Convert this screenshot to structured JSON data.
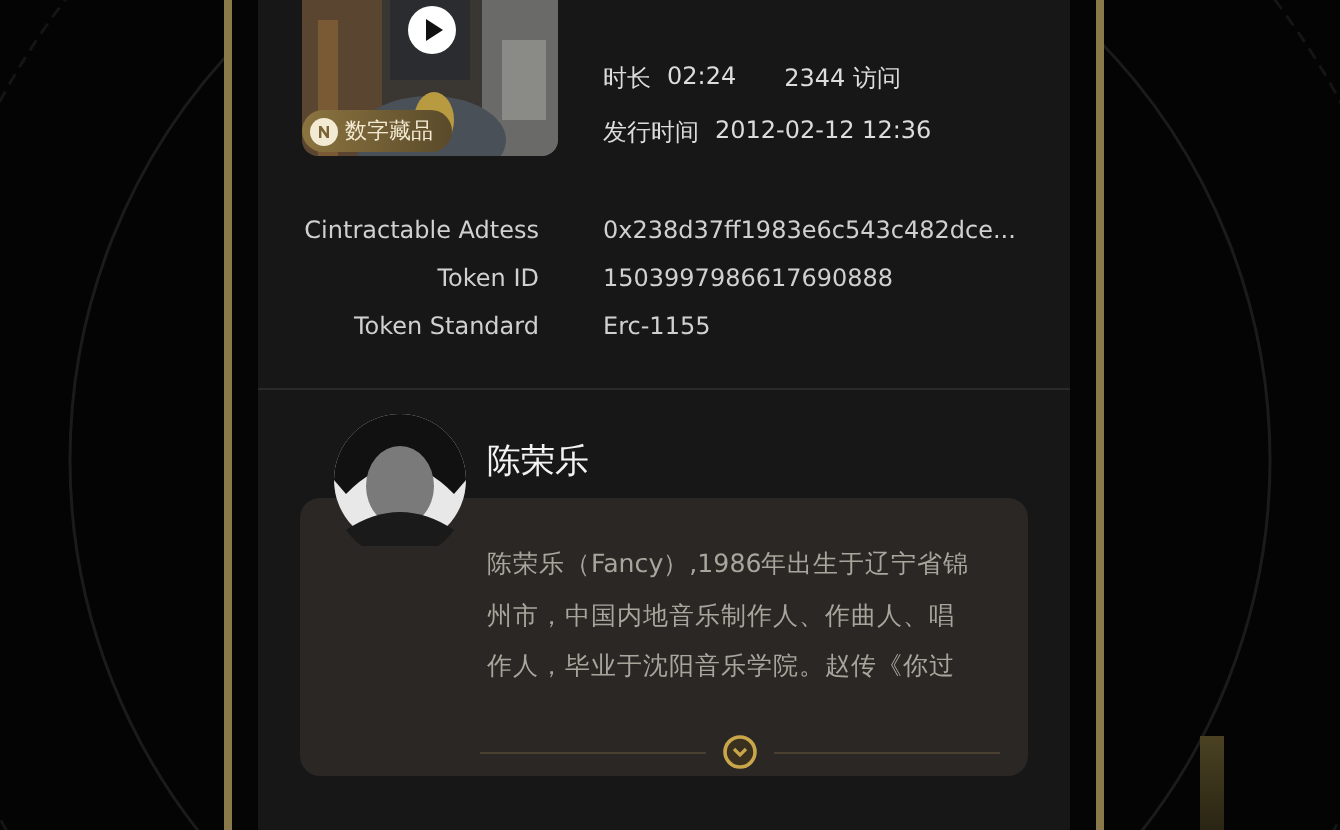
{
  "media": {
    "badge": "数字藏品",
    "duration_label": "时长",
    "duration": "02:24",
    "visits": "2344 访问",
    "release_label": "发行时间",
    "release_time": "2012-02-12 12:36"
  },
  "token_info": [
    {
      "label": "Cintractable Adtess",
      "value": "0x238d37ff1983e6c543c482dce..."
    },
    {
      "label": "Token ID",
      "value": "1503997986617690888"
    },
    {
      "label": "Token Standard",
      "value": "Erc-1155"
    }
  ],
  "artist": {
    "name": "陈荣乐",
    "bio_lines": [
      "陈荣乐（Fancy）,1986年出生于辽宁省锦",
      "州市，中国内地音乐制作人、作曲人、唱",
      "作人，毕业于沈阳音乐学院。赵传《你过"
    ],
    "expanded": false
  }
}
